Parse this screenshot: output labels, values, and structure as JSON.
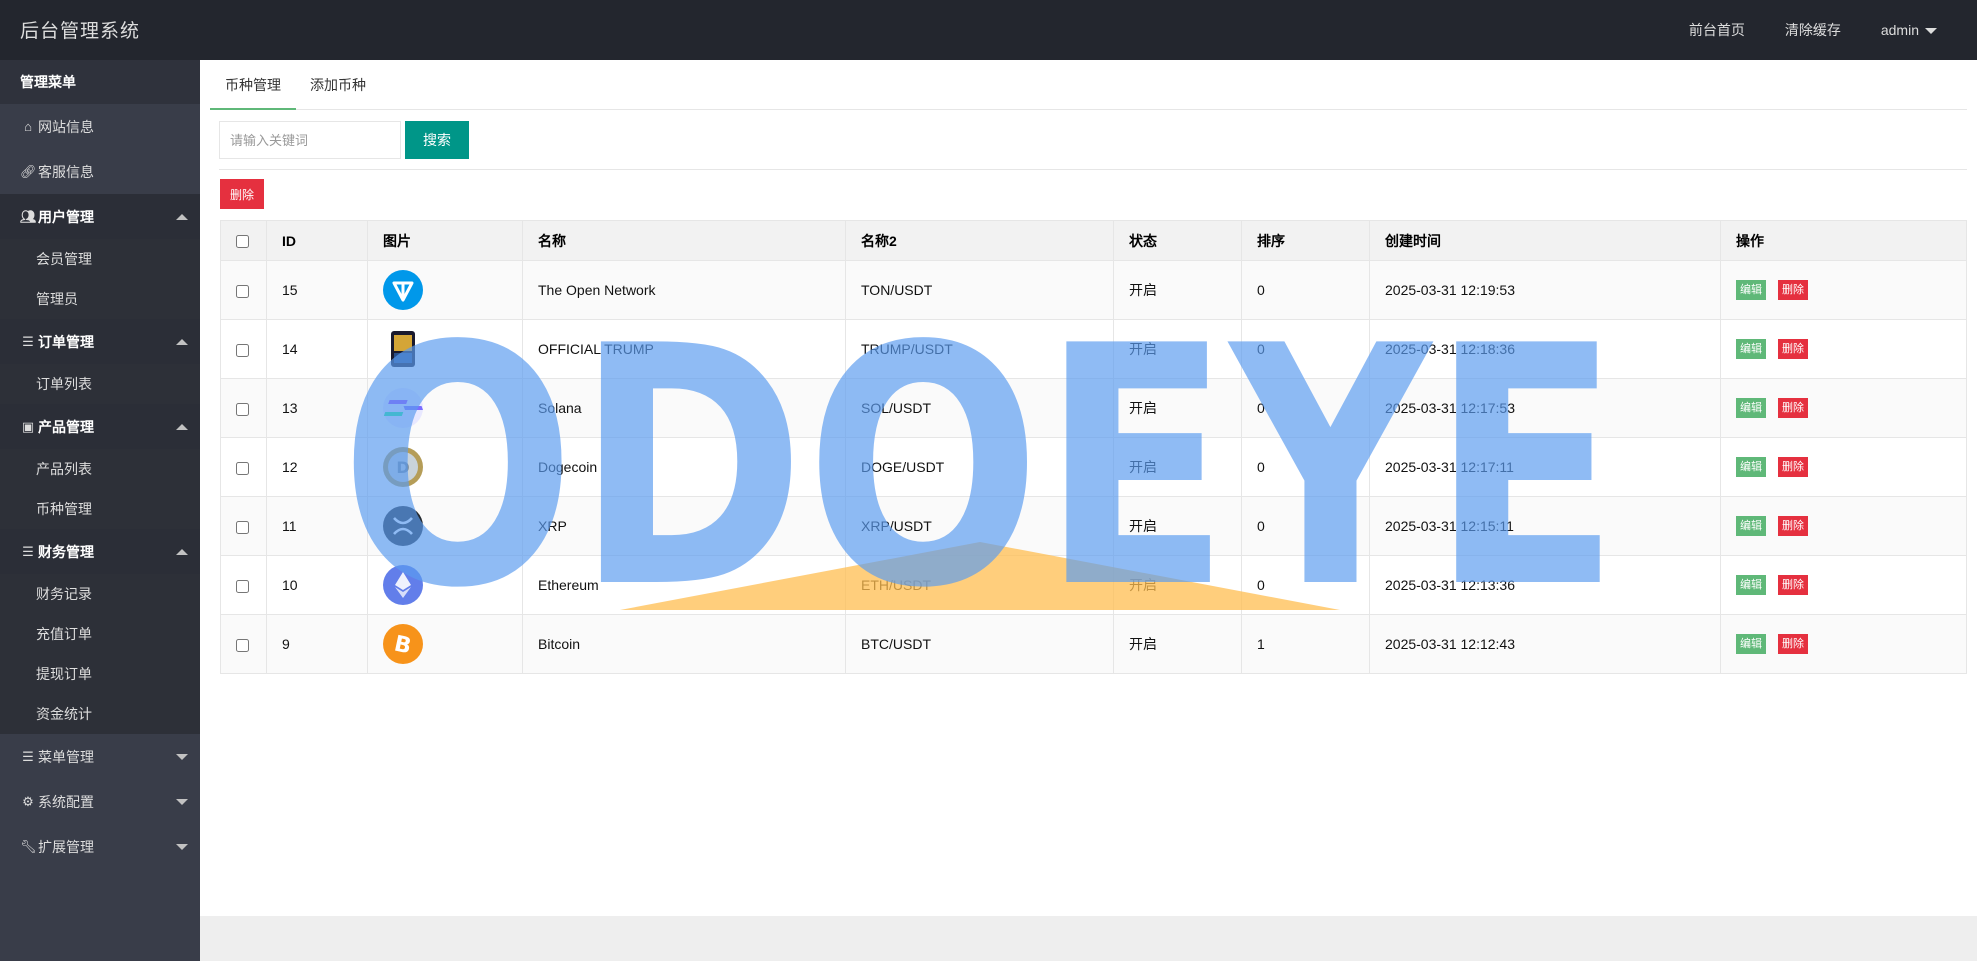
{
  "header": {
    "title": "后台管理系统",
    "nav": [
      "前台首页",
      "清除缓存",
      "admin"
    ]
  },
  "sidebar": {
    "title": "管理菜单",
    "items": [
      {
        "label": "网站信息",
        "icon": "home-icon"
      },
      {
        "label": "客服信息",
        "icon": "link-icon"
      }
    ],
    "groups": [
      {
        "label": "用户管理",
        "icon": "users-icon",
        "expanded": true,
        "children": [
          "会员管理",
          "管理员"
        ]
      },
      {
        "label": "订单管理",
        "icon": "list-icon",
        "expanded": true,
        "children": [
          "订单列表"
        ]
      },
      {
        "label": "产品管理",
        "icon": "archive-icon",
        "expanded": true,
        "children": [
          "产品列表",
          "币种管理"
        ]
      },
      {
        "label": "财务管理",
        "icon": "list-icon",
        "expanded": true,
        "children": [
          "财务记录",
          "充值订单",
          "提现订单",
          "资金统计"
        ]
      },
      {
        "label": "菜单管理",
        "icon": "list-icon",
        "expanded": false,
        "children": []
      },
      {
        "label": "系统配置",
        "icon": "cogs-icon",
        "expanded": false,
        "children": []
      },
      {
        "label": "扩展管理",
        "icon": "wrench-icon",
        "expanded": false,
        "children": []
      }
    ]
  },
  "tabs": [
    {
      "label": "币种管理",
      "active": true
    },
    {
      "label": "添加币种",
      "active": false
    }
  ],
  "search": {
    "placeholder": "请输入关键词",
    "value": "",
    "button": "搜索"
  },
  "bulk_delete": "删除",
  "table": {
    "columns": [
      "ID",
      "图片",
      "名称",
      "名称2",
      "状态",
      "排序",
      "创建时间",
      "操作"
    ],
    "rows": [
      {
        "id": "15",
        "coin": "ton",
        "name": "The Open Network",
        "pair": "TON/USDT",
        "status": "开启",
        "sort": "0",
        "created": "2025-03-31 12:19:53"
      },
      {
        "id": "14",
        "coin": "trump",
        "name": "OFFICIAL TRUMP",
        "pair": "TRUMP/USDT",
        "status": "开启",
        "sort": "0",
        "created": "2025-03-31 12:18:36"
      },
      {
        "id": "13",
        "coin": "sol",
        "name": "Solana",
        "pair": "SOL/USDT",
        "status": "开启",
        "sort": "0",
        "created": "2025-03-31 12:17:53"
      },
      {
        "id": "12",
        "coin": "doge",
        "name": "Dogecoin",
        "pair": "DOGE/USDT",
        "status": "开启",
        "sort": "0",
        "created": "2025-03-31 12:17:11"
      },
      {
        "id": "11",
        "coin": "xrp",
        "name": "XRP",
        "pair": "XRP/USDT",
        "status": "开启",
        "sort": "0",
        "created": "2025-03-31 12:15:11"
      },
      {
        "id": "10",
        "coin": "eth",
        "name": "Ethereum",
        "pair": "ETH/USDT",
        "status": "开启",
        "sort": "0",
        "created": "2025-03-31 12:13:36"
      },
      {
        "id": "9",
        "coin": "btc",
        "name": "Bitcoin",
        "pair": "BTC/USDT",
        "status": "开启",
        "sort": "1",
        "created": "2025-03-31 12:12:43"
      }
    ],
    "edit_label": "编辑",
    "delete_label": "删除"
  },
  "watermark": {
    "text": "ODOEYE"
  },
  "colors": {
    "header_bg": "#23262e",
    "sidebar_bg": "#393d49",
    "primary": "#009688",
    "edit": "#5fb878",
    "danger": "#e5303f",
    "watermark_blue": "#5b9cf0",
    "watermark_orange": "#ffbe50"
  }
}
